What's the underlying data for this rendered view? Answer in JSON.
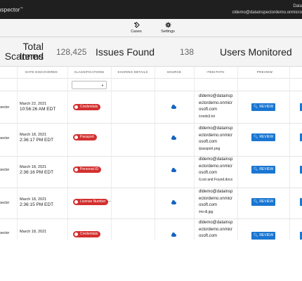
{
  "header": {
    "brand": "nspector",
    "account_line1": "Data",
    "account_line2": "cldemo@datainspectordemo.onmicro"
  },
  "nav": [
    {
      "label": "Cases",
      "icon": "cases-icon"
    },
    {
      "label": "Settings",
      "icon": "gear-icon"
    }
  ],
  "summary": {
    "total_label_1": "Total Items",
    "total_label_2": "Scanned",
    "total_value": "128,425",
    "issues_label": "Issues Found",
    "issues_value": "138",
    "users_label": "Users Monitored"
  },
  "table": {
    "headers": [
      "DATE DISCOVERED",
      "CLASSIFICATIONS",
      "SHARING DETAILS",
      "SOURCE",
      "ITEM PATH",
      "PREVIEW"
    ],
    "review_label": "REVIEW",
    "rows": [
      {
        "inspector": "nspector",
        "date": "March 22, 2021",
        "time": "10:56:26 AM EDT",
        "classification": "Credentials",
        "more": "",
        "path1": "dldemo@datainsp",
        "path2": "ectordemo.onmicr",
        "path3": "osoft.com",
        "file": "/creds3.txt"
      },
      {
        "inspector": "nspector",
        "date": "March 18, 2021",
        "time": "2:36:17 PM EDT",
        "classification": "Passport",
        "more": "",
        "path1": "dldemo@datainsp",
        "path2": "ectordemo.onmicr",
        "path3": "osoft.com",
        "file": "/passport.png"
      },
      {
        "inspector": "nspector",
        "date": "March 18, 2021",
        "time": "2:36:16 PM EDT",
        "classification": "Personal ID",
        "more": "",
        "path1": "dldemo@datainsp",
        "path2": "ectordemo.onmicr",
        "path3": "osoft.com",
        "file": "/Lost and Found.docx"
      },
      {
        "inspector": "nspector",
        "date": "March 18, 2021",
        "time": "2:36:15 PM EDT",
        "classification": "License Number",
        "more": "...",
        "path1": "dldemo@datainsp",
        "path2": "ectordemo.onmicr",
        "path3": "osoft.com",
        "file": "/mi-dl.jpg"
      },
      {
        "inspector": "nspector",
        "date": "March 18, 2021",
        "time": "",
        "classification": "Credentials",
        "more": "",
        "path1": "dldemo@datainsp",
        "path2": "ectordemo.onmicr",
        "path3": "osoft.com",
        "file": ""
      }
    ]
  },
  "colors": {
    "topbar": "#1f1f1f",
    "badge": "#d32f2f",
    "button": "#1976d2",
    "cloud": "#1565c0"
  }
}
